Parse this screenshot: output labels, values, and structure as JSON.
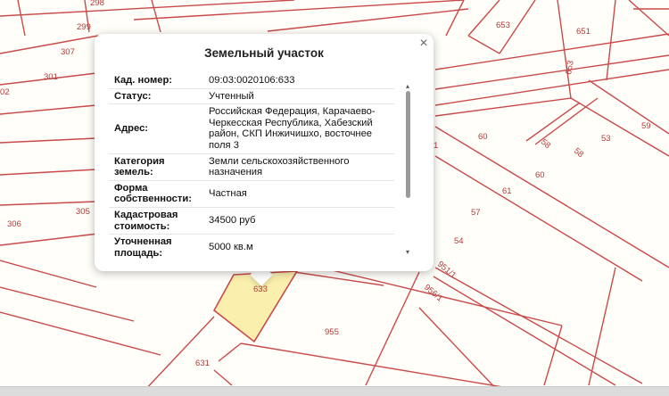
{
  "map": {
    "parcel_fill": "#fbefad",
    "boundary_color": "#c94a4a",
    "plot_labels": [
      "298",
      "299",
      "307",
      "301",
      "02",
      "305",
      "306",
      "653",
      "651",
      "653",
      "1",
      "60",
      "58",
      "58",
      "53",
      "59",
      "60",
      "61",
      "57",
      "54",
      "951/1",
      "956/1",
      "633",
      "955",
      "631"
    ]
  },
  "popup": {
    "title": "Земельный участок",
    "close_glyph": "×",
    "rows": [
      {
        "key": "Кад. номер:",
        "value": "09:03:0020106:633"
      },
      {
        "key": "Статус:",
        "value": "Учтенный"
      },
      {
        "key": "Адрес:",
        "value": "Российская Федерация, Карачаево-Черкесская Республика, Хабезский район, СКП Инжичишхо, восточнее поля 3"
      },
      {
        "key": "Категория земель:",
        "value": "Земли сельскохозяйственного назначения"
      },
      {
        "key": "Форма собственности:",
        "value": "Частная"
      },
      {
        "key": "Кадастровая стоимость:",
        "value": "34500 руб"
      },
      {
        "key": "Уточненная площадь:",
        "value": "5000 кв.м"
      }
    ],
    "scroll_up_glyph": "▴",
    "scroll_down_glyph": "▾"
  }
}
